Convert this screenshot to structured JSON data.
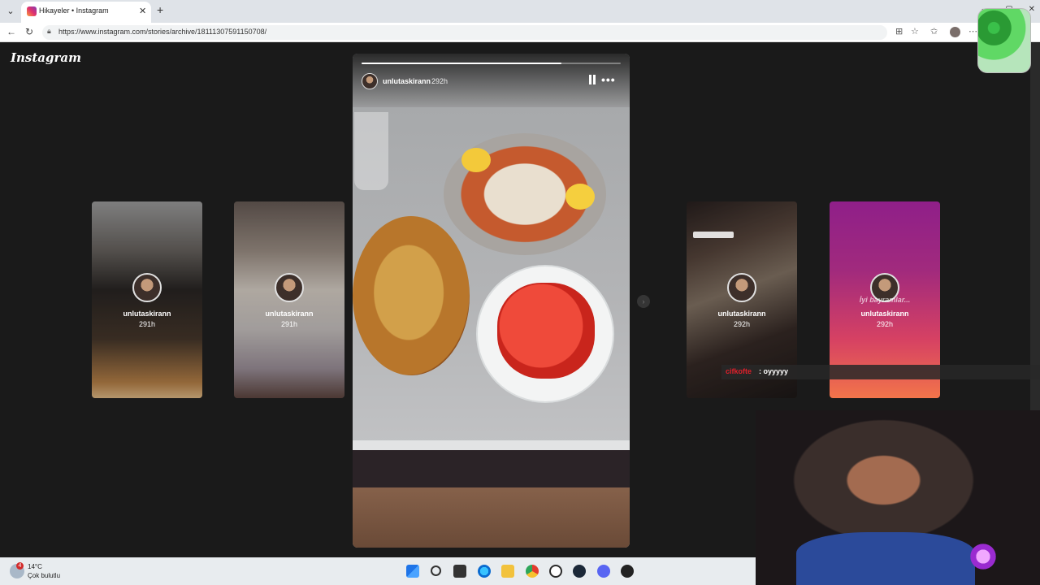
{
  "browser": {
    "tab_title": "Hikayeler • Instagram",
    "tab_close": "✕",
    "new_tab": "+",
    "url": "https://www.instagram.com/stories/archive/18111307591150708/",
    "window_controls": [
      "—",
      "▢",
      "✕"
    ]
  },
  "page": {
    "logo": "Instagram",
    "story": {
      "username": "unlutaskirann",
      "time": "292h",
      "progress_fraction": 0.77,
      "more_label": "•••"
    },
    "preview_cards": [
      {
        "username": "unlutaskirann",
        "time": "291h"
      },
      {
        "username": "unlutaskirann",
        "time": "291h"
      },
      {
        "username": "unlutaskirann",
        "time": "292h"
      },
      {
        "username": "unlutaskirann",
        "time": "292h",
        "overlay_text": "İyi bayramlar..."
      }
    ],
    "next_arrow": "›"
  },
  "chat": {
    "user": "cifkofte",
    "message": ": oyyyyy"
  },
  "taskbar": {
    "temperature": "14°C",
    "weather": "Çok bulutlu",
    "weather_badge": "4"
  },
  "icons": {
    "back": "back-arrow-icon",
    "reload": "reload-icon",
    "lock": "lock-icon",
    "pause": "pause-icon"
  }
}
